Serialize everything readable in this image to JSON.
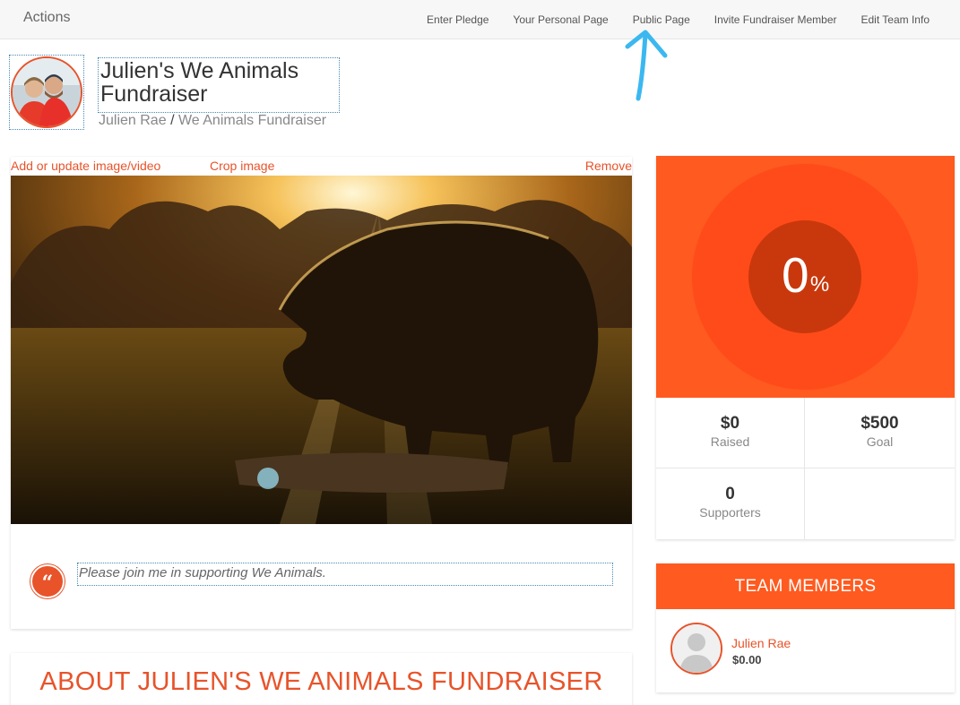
{
  "app": {
    "title": "Actions"
  },
  "nav": {
    "items": [
      {
        "label": "Enter Pledge"
      },
      {
        "label": "Your Personal Page"
      },
      {
        "label": "Public Page"
      },
      {
        "label": "Invite Fundraiser Member"
      },
      {
        "label": "Edit Team Info"
      }
    ]
  },
  "header": {
    "title": "Julien's We Animals Fundraiser",
    "breadcrumb": {
      "owner": "Julien Rae",
      "separator": "/",
      "page": "We Animals Fundraiser"
    }
  },
  "media": {
    "add_label": "Add or update image/video",
    "crop_label": "Crop image",
    "remove_label": "Remove",
    "quote": "Please join me in supporting We Animals.",
    "quote_icon": "quote-icon"
  },
  "about": {
    "heading": "ABOUT JULIEN'S WE ANIMALS FUNDRAISER"
  },
  "progress": {
    "percent_value": "0",
    "percent_sign": "%",
    "fraction": 0,
    "stats": [
      {
        "value": "$0",
        "label": "Raised"
      },
      {
        "value": "$500",
        "label": "Goal"
      },
      {
        "value": "0",
        "label": "Supporters"
      }
    ]
  },
  "team": {
    "heading": "TEAM MEMBERS",
    "members": [
      {
        "name": "Julien Rae",
        "amount": "$0.00"
      }
    ]
  },
  "colors": {
    "accent": "#e8532a",
    "progress_bg": "#ff5a1f",
    "progress_inner": "#c9380c",
    "annotation": "#3bb8f0"
  }
}
